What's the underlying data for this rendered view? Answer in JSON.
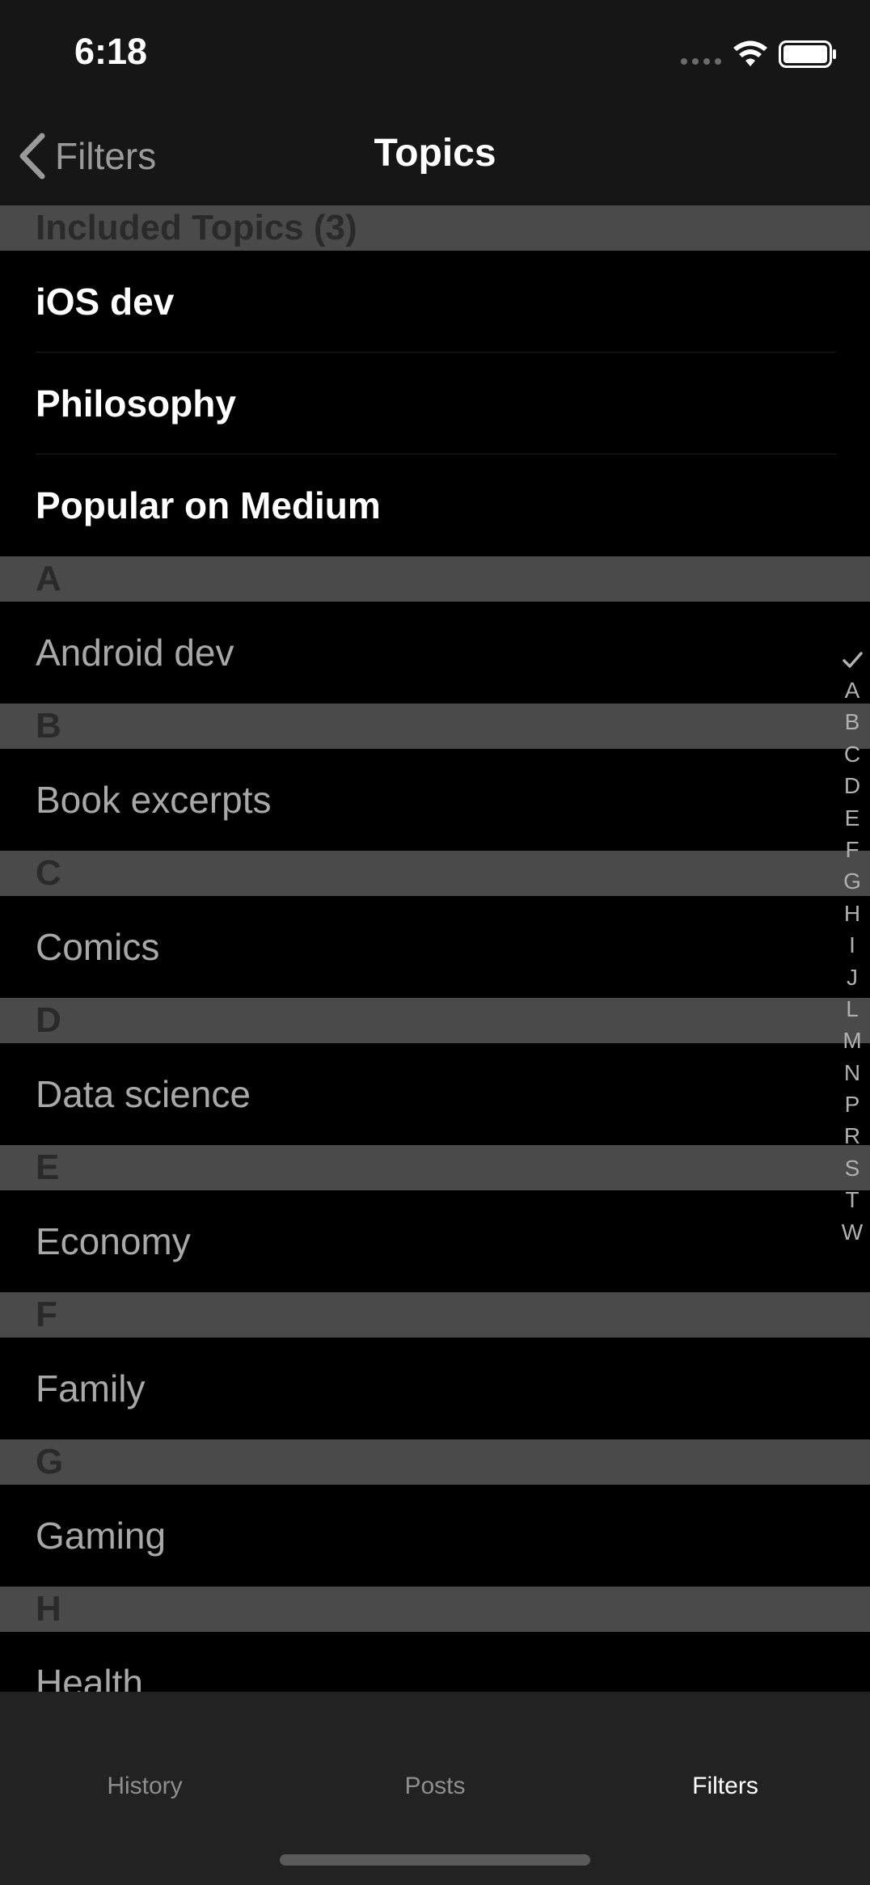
{
  "status": {
    "time": "6:18"
  },
  "nav": {
    "back_label": "Filters",
    "title": "Topics"
  },
  "included": {
    "header": "Included Topics (3)",
    "items": [
      "iOS dev",
      "Philosophy",
      "Popular on Medium"
    ]
  },
  "sections": [
    {
      "letter": "A",
      "item": "Android dev"
    },
    {
      "letter": "B",
      "item": "Book excerpts"
    },
    {
      "letter": "C",
      "item": "Comics"
    },
    {
      "letter": "D",
      "item": "Data science"
    },
    {
      "letter": "E",
      "item": "Economy"
    },
    {
      "letter": "F",
      "item": "Family"
    },
    {
      "letter": "G",
      "item": "Gaming"
    },
    {
      "letter": "H",
      "item": "Health"
    }
  ],
  "index_letters": [
    "A",
    "B",
    "C",
    "D",
    "E",
    "F",
    "G",
    "H",
    "I",
    "J",
    "L",
    "M",
    "N",
    "P",
    "R",
    "S",
    "T",
    "W"
  ],
  "tabs": [
    {
      "label": "History",
      "active": false
    },
    {
      "label": "Posts",
      "active": false
    },
    {
      "label": "Filters",
      "active": true
    }
  ],
  "colors": {
    "background": "#000000",
    "bar": "#161616",
    "section_header": "#4a4a4a",
    "tab_bar": "#222222"
  },
  "icons": {
    "back": "chevron-left-icon",
    "index_top": "checkmark-icon",
    "signal": "signal-icon",
    "wifi": "wifi-icon",
    "battery": "battery-icon"
  }
}
